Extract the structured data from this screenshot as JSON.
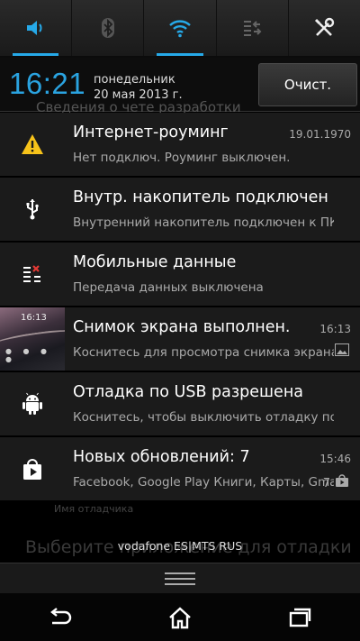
{
  "quick_settings": [
    {
      "name": "sound",
      "icon": "speaker-icon",
      "active": true
    },
    {
      "name": "bluetooth",
      "icon": "bluetooth-icon",
      "active": false
    },
    {
      "name": "wifi",
      "icon": "wifi-icon",
      "active": true
    },
    {
      "name": "mobile-data",
      "icon": "data-transfer-icon",
      "active": false
    },
    {
      "name": "settings",
      "icon": "tools-icon",
      "active": false
    }
  ],
  "header": {
    "time": "16:21",
    "weekday": "понедельник",
    "date": "20 мая 2013 г.",
    "clear_label": "Очист.",
    "behind_text": "Сведения о чете разработки"
  },
  "notifications": [
    {
      "title": "Интернет-роуминг",
      "subtitle": "Нет подключ. Роуминг выключен.",
      "time": "19.01.1970",
      "icon": "warning-icon"
    },
    {
      "title": "Внутр. накопитель подключен",
      "subtitle": "Внутренний накопитель подключен к ПК",
      "time": "",
      "icon": "usb-icon"
    },
    {
      "title": "Мобильные данные",
      "subtitle": "Передача данных выключена",
      "time": "",
      "icon": "data-off-icon"
    },
    {
      "title": "Снимок экрана выполнен.",
      "subtitle": "Коснитесь для просмотра снимка экрана",
      "time": "16:13",
      "icon": "screenshot-thumbnail",
      "thumb_time": "16:13"
    },
    {
      "title": "Отладка по USB разрешена",
      "subtitle": "Коснитесь, чтобы выключить отладку по USB",
      "time": "",
      "icon": "android-icon"
    },
    {
      "title": "Новых обновлений: 7",
      "subtitle": "Facebook, Google Play Книги, Карты, Gmail",
      "time": "15:46",
      "count": "7",
      "icon": "play-store-icon"
    }
  ],
  "behind": {
    "small": "Имя отладчика",
    "large": "Выберите приложение для отладки"
  },
  "carrier": "vodafone ES|MTS RUS",
  "nav": {
    "back": "back-icon",
    "home": "home-icon",
    "recents": "recents-icon"
  },
  "colors": {
    "accent": "#26a9e8",
    "clock": "#2aa3e0",
    "warning": "#f7c31a"
  }
}
